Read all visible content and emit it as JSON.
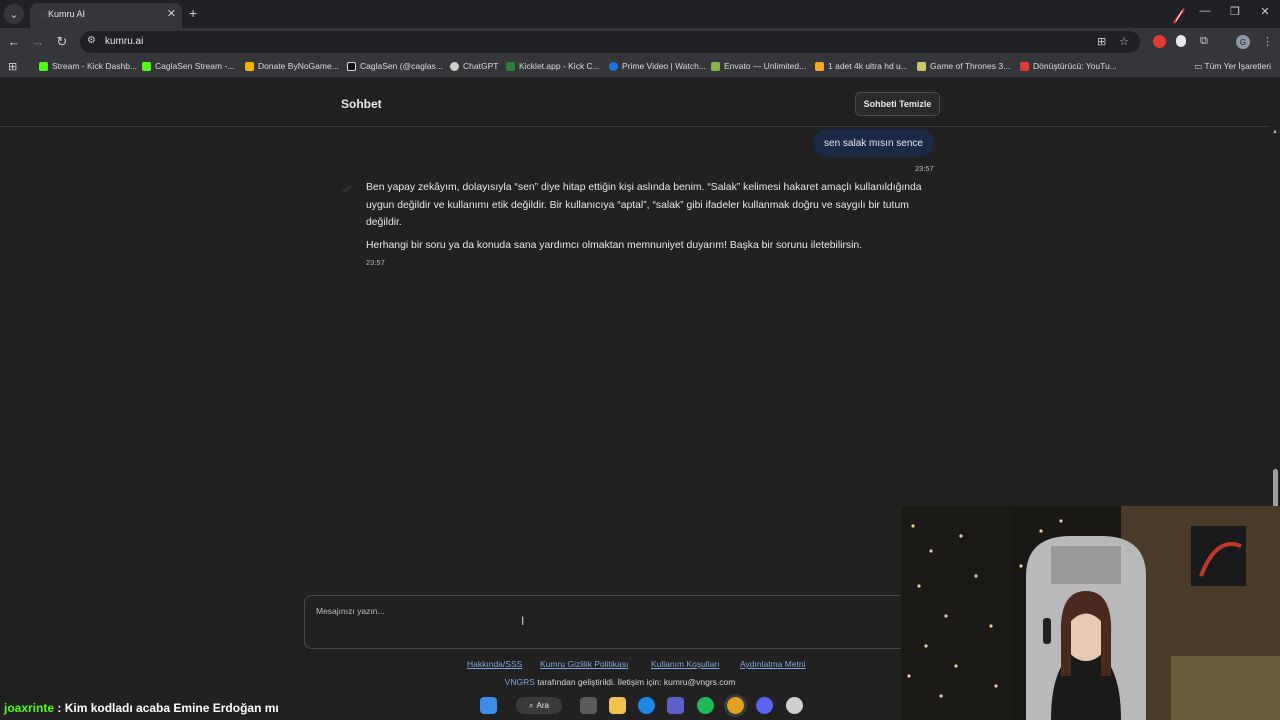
{
  "browser": {
    "tab_title": "Kumru AI",
    "url": "kumru.ai",
    "bookmarks": [
      {
        "label": "Stream - Kick Dashb...",
        "color": "#53fc18"
      },
      {
        "label": "CaglaSen Stream -...",
        "color": "#53fc18"
      },
      {
        "label": "Donate ByNoGame...",
        "color": "#f5b400"
      },
      {
        "label": "CaglaSen (@caglas...",
        "color": "#ffffff"
      },
      {
        "label": "ChatGPT",
        "color": "#cfcfcf"
      },
      {
        "label": "Kicklet.app - Kick C...",
        "color": "#2e7d32"
      },
      {
        "label": "Prime Video | Watch...",
        "color": "#1a73e8"
      },
      {
        "label": "Envato — Unlimited...",
        "color": "#82b541"
      },
      {
        "label": "1 adet 4k ultra hd u...",
        "color": "#f5a623"
      },
      {
        "label": "Game of Thrones 3...",
        "color": "#c8c86e"
      },
      {
        "label": "Dönüştürücü: YouTu...",
        "color": "#e53935"
      }
    ],
    "all_bookmarks_label": "Tüm Yer İşaretleri"
  },
  "page": {
    "title": "Sohbet",
    "clear_button": "Sohbeti Temizle",
    "user_message": "sen salak mısın sence",
    "user_time": "23:57",
    "assistant_paragraph_1": "Ben yapay zekâyım, dolayısıyla “sen” diye hitap ettiğin kişi aslında benim. “Salak” kelimesi hakaret amaçlı kullanıldığında uygun değildir ve kullanımı etik değildir. Bir kullanıcıya “aptal”, “salak” gibi ifadeler kullanmak doğru ve saygılı bir tutum değildir.",
    "assistant_paragraph_2": "Herhangi bir soru ya da konuda sana yardımcı olmaktan memnuniyet duyarım! Başka bir sorunu iletebilirsin.",
    "assistant_time": "23:57",
    "composer_placeholder": "Mesajınızı yazın...",
    "footer_links": [
      "Hakkında/SSS",
      "Kumru Gizlilik Politikası",
      "Kullanım Koşulları",
      "Aydınlatma Metni"
    ],
    "credit_brand": "VNGRS",
    "credit_text": " tarafından geliştirildi. İletişim için: kumru@vngrs.com"
  },
  "stream_chat": {
    "username": "joaxrinte",
    "separator": " : ",
    "message": "Kim kodladı acaba Emine Erdoğan mı"
  },
  "taskbar": {
    "search_label": "Ara"
  }
}
